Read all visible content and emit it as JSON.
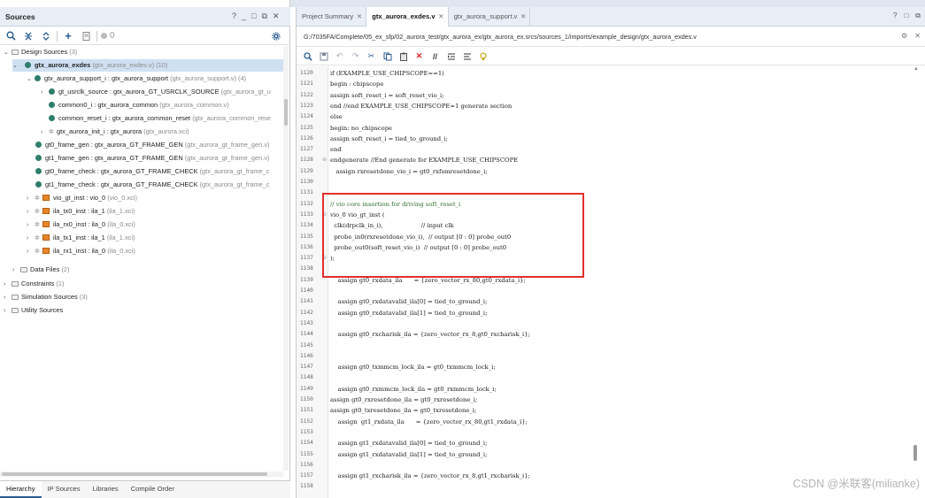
{
  "sources_panel": {
    "title": "Sources",
    "window_controls": [
      "?",
      "_",
      "□",
      "⧉",
      "✕"
    ],
    "toolbar": {
      "counter": "0"
    },
    "tree": [
      {
        "label": "Design Sources",
        "suffix": "(3)"
      },
      {
        "label": "gtx_aurora_exdes",
        "suffix": "(gtx_aurora_exdes.v) (10)"
      },
      {
        "label": "gtx_aurora_support_i : gtx_aurora_support",
        "suffix": "(gtx_aurora_support.v) (4)"
      },
      {
        "label": "gt_usrclk_source : gtx_aurora_GT_USRCLK_SOURCE",
        "suffix": "(gtx_aurora_gt_u"
      },
      {
        "label": "common0_i : gtx_aurora_common",
        "suffix": "(gtx_aurora_common.v)"
      },
      {
        "label": "common_reset_i : gtx_aurora_common_reset",
        "suffix": "(gtx_aurora_common_rese"
      },
      {
        "label": "gtx_aurora_init_i : gtx_aurora",
        "suffix": "(gtx_aurora.xci)"
      },
      {
        "label": "gt0_frame_gen : gtx_aurora_GT_FRAME_GEN",
        "suffix": "(gtx_aurora_gt_frame_gen.v)"
      },
      {
        "label": "gt1_frame_gen : gtx_aurora_GT_FRAME_GEN",
        "suffix": "(gtx_aurora_gt_frame_gen.v)"
      },
      {
        "label": "gt0_frame_check : gtx_aurora_GT_FRAME_CHECK",
        "suffix": "(gtx_aurora_gt_frame_c"
      },
      {
        "label": "gt1_frame_check : gtx_aurora_GT_FRAME_CHECK",
        "suffix": "(gtx_aurora_gt_frame_c"
      },
      {
        "label": "vio_gt_inst : vio_0",
        "suffix": "(vio_0.xci)"
      },
      {
        "label": "ila_tx0_inst : ila_1",
        "suffix": "(ila_1.xci)"
      },
      {
        "label": "ila_rx0_inst : ila_0",
        "suffix": "(ila_0.xci)"
      },
      {
        "label": "ila_tx1_inst : ila_1",
        "suffix": "(ila_1.xci)"
      },
      {
        "label": "ila_rx1_inst : ila_0",
        "suffix": "(ila_0.xci)"
      },
      {
        "label": "Data Files",
        "suffix": "(2)"
      },
      {
        "label": "Constraints",
        "suffix": "(1)"
      },
      {
        "label": "Simulation Sources",
        "suffix": "(3)"
      },
      {
        "label": "Utility Sources",
        "suffix": ""
      }
    ],
    "bottom_tabs": [
      "Hierarchy",
      "IP Sources",
      "Libraries",
      "Compile Order"
    ]
  },
  "editor": {
    "tabs": [
      "Project Summary",
      "gtx_aurora_exdes.v",
      "gtx_aurora_support.v"
    ],
    "file_path": "G:/7035FA/Complete/05_ex_sfp/02_aurora_test/gtx_aurora_ex/gtx_aurora_ex.srcs/sources_1/imports/example_design/gtx_aurora_exdes.v",
    "window_controls": [
      "?",
      "□",
      "⧉"
    ],
    "path_controls": [
      "⚙",
      "✕"
    ],
    "code_lines": [
      {
        "n": "1120",
        "t": "if (EXAMPLE_USE_CHIPSCOPE==1)"
      },
      {
        "n": "1121",
        "t": "begin : chipscope"
      },
      {
        "n": "1122",
        "t": "assign soft_reset_i = soft_reset_vio_i;"
      },
      {
        "n": "1123",
        "t": "end //end EXAMPLE_USE_CHIPSCOPE=1 generate section"
      },
      {
        "n": "1124",
        "t": "else"
      },
      {
        "n": "1125",
        "t": "begin: no_chipscope"
      },
      {
        "n": "1126",
        "t": "assign soft_reset_i = tied_to_ground_i;"
      },
      {
        "n": "1127",
        "t": "end"
      },
      {
        "n": "1128",
        "t": "endgenerate //End generate for EXAMPLE_USE_CHIPSCOPE"
      },
      {
        "n": "1129",
        "t": "   assign rxresetdone_vio_i = gt0_rxfsmresetdone_i;"
      },
      {
        "n": "1130",
        "t": ""
      },
      {
        "n": "1131",
        "t": ""
      },
      {
        "n": "1132",
        "t": "// vio core insertion for driving soft_reset_i"
      },
      {
        "n": "1133",
        "t": "vio_0 vio_gt_inst ("
      },
      {
        "n": "1134",
        "t": "  clk(drpclk_in_i),                    // input clk"
      },
      {
        "n": "1135",
        "t": "  probe_in0(rxresetdone_vio_i),  // output [0 : 0] probe_out0"
      },
      {
        "n": "1136",
        "t": "  probe_out0(soft_reset_vio_i)  // output [0 : 0] probe_out0"
      },
      {
        "n": "1137",
        "t": ");"
      },
      {
        "n": "1138",
        "t": ""
      },
      {
        "n": "1139",
        "t": "    assign gt0_rxdata_ila      = {zero_vector_rx_80,gt0_rxdata_i};"
      },
      {
        "n": "1140",
        "t": ""
      },
      {
        "n": "1141",
        "t": "    assign gt0_rxdatavalid_ila[0] = tied_to_ground_i;"
      },
      {
        "n": "1142",
        "t": "    assign gt0_rxdatavalid_ila[1] = tied_to_ground_i;"
      },
      {
        "n": "1143",
        "t": ""
      },
      {
        "n": "1144",
        "t": "    assign gt0_rxcharisk_ila = {zero_vector_rx_8,gt0_rxcharisk_i};"
      },
      {
        "n": "1145",
        "t": ""
      },
      {
        "n": "1146",
        "t": ""
      },
      {
        "n": "1147",
        "t": "    assign gt0_txmmcm_lock_ila = gt0_txmmcm_lock_i;"
      },
      {
        "n": "1148",
        "t": ""
      },
      {
        "n": "1149",
        "t": "    assign gt0_rxmmcm_lock_ila = gt0_rxmmcm_lock_i;"
      },
      {
        "n": "1150",
        "t": "assign gt0_rxresetdone_ila = gt0_rxresetdone_i;"
      },
      {
        "n": "1151",
        "t": "assign gt0_txresetdone_ila = gt0_txresetdone_i;"
      },
      {
        "n": "1152",
        "t": "    assign  gt1_rxdata_ila      = {zero_vector_rx_80,gt1_rxdata_i};"
      },
      {
        "n": "1153",
        "t": ""
      },
      {
        "n": "1154",
        "t": "    assign gt1_rxdatavalid_ila[0] = tied_to_ground_i;"
      },
      {
        "n": "1155",
        "t": "    assign gt1_rxdatavalid_ila[1] = tied_to_ground_i;"
      },
      {
        "n": "1156",
        "t": ""
      },
      {
        "n": "1157",
        "t": "    assign gt1_rxcharisk_ila = {zero_vector_rx_8,gt1_rxcharisk_i};"
      },
      {
        "n": "1158",
        "t": ""
      }
    ]
  },
  "watermark": "CSDN @米联客(milianke)",
  "colors": {
    "highlight_box": "#e0302c",
    "selection": "#cfe0f3",
    "accent": "#2b5d8f"
  }
}
